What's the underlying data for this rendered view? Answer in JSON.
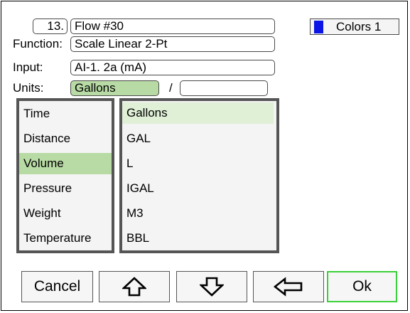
{
  "header": {
    "index": "13.",
    "name": "Flow #30",
    "colors_label": "Colors 1",
    "colors_swatch": "#0a14e6"
  },
  "function": {
    "label": "Function:",
    "value": "Scale Linear 2-Pt"
  },
  "input": {
    "label": "Input:",
    "value": "AI-1. 2a (mA)"
  },
  "units": {
    "label": "Units:",
    "value": "Gallons",
    "separator": "/",
    "denominator": ""
  },
  "categories": [
    {
      "label": "Time"
    },
    {
      "label": "Distance"
    },
    {
      "label": "Volume"
    },
    {
      "label": "Pressure"
    },
    {
      "label": "Weight"
    },
    {
      "label": "Temperature"
    }
  ],
  "unit_options": [
    {
      "label": "Gallons"
    },
    {
      "label": "GAL"
    },
    {
      "label": "L"
    },
    {
      "label": "IGAL"
    },
    {
      "label": "M3"
    },
    {
      "label": "BBL"
    }
  ],
  "buttons": {
    "cancel": "Cancel",
    "up_icon": "arrow-up-icon",
    "down_icon": "arrow-down-icon",
    "back_icon": "arrow-left-icon",
    "ok": "Ok"
  },
  "colors": {
    "selected": "#b8dba5",
    "highlight": "#dff0d7",
    "ok_border": "#3bd13b"
  }
}
